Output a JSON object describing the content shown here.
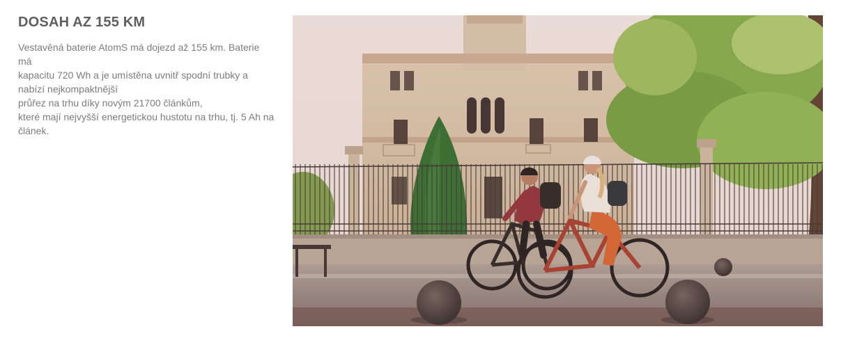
{
  "section": {
    "title": "DOSAH AZ 155 KM",
    "description_lines": [
      "Vestavěná baterie AtomS má dojezd až 155 km. Baterie",
      "má",
      "kapacitu 720 Wh a je umístěna uvnitř spodní trubky a",
      "nabízí nejkompaktnější",
      "průřez na trhu díky novým 21700 článkům,",
      "které mají nejvyšší energetickou hustotu na trhu, tj. 5 Ah na",
      "článek."
    ]
  },
  "photo": {
    "subject": "two cyclists on e-bikes in front of a historic building"
  }
}
